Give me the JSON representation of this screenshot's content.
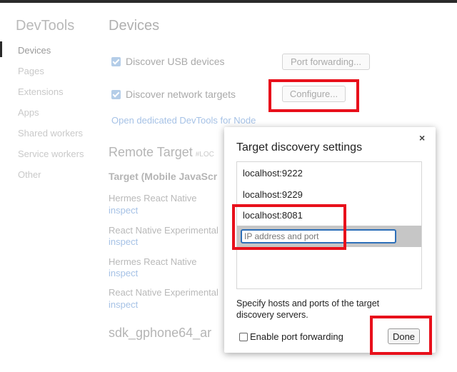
{
  "sidebar": {
    "title": "DevTools",
    "items": [
      {
        "label": "Devices"
      },
      {
        "label": "Pages"
      },
      {
        "label": "Extensions"
      },
      {
        "label": "Apps"
      },
      {
        "label": "Shared workers"
      },
      {
        "label": "Service workers"
      },
      {
        "label": "Other"
      }
    ]
  },
  "main": {
    "title": "Devices",
    "discover_usb": {
      "label": "Discover USB devices",
      "checked": true
    },
    "port_forwarding_button": "Port forwarding...",
    "discover_network": {
      "label": "Discover network targets",
      "checked": true
    },
    "configure_button": "Configure...",
    "node_link": "Open dedicated DevTools for Node",
    "remote_target": {
      "title": "Remote Target",
      "tag": "#LOC"
    },
    "target_header": "Target (Mobile JavaScr",
    "targets": [
      {
        "name": "Hermes React Native",
        "action": "inspect"
      },
      {
        "name": "React Native Experimental",
        "action": "inspect"
      },
      {
        "name": "Hermes React Native",
        "action": "inspect"
      },
      {
        "name": "React Native Experimental",
        "action": "inspect"
      }
    ],
    "device_header": "sdk_gphone64_ar"
  },
  "dialog": {
    "title": "Target discovery settings",
    "close_glyph": "×",
    "hosts": [
      "localhost:9222",
      "localhost:9229",
      "localhost:8081"
    ],
    "new_host_placeholder": "IP address and port",
    "help_text": "Specify hosts and ports of the target discovery servers.",
    "enable_port_forwarding": {
      "label": "Enable port forwarding",
      "checked": false
    },
    "done_button": "Done"
  },
  "colors": {
    "highlight": "#e8101b",
    "link": "#a6c2e6",
    "focus": "#2d6fb8"
  }
}
